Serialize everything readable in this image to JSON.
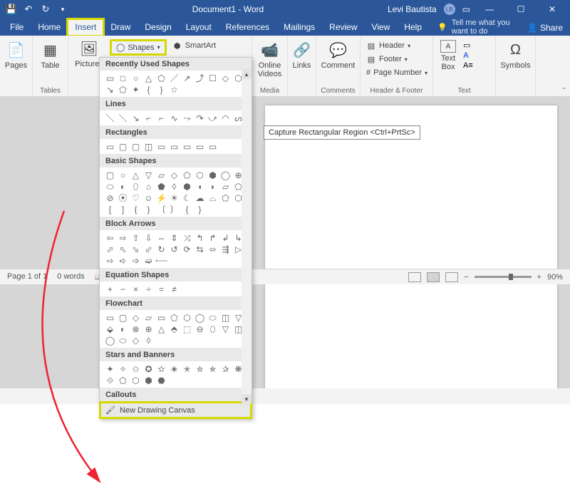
{
  "title": "Document1 - Word",
  "user": {
    "name": "Levi Bautista",
    "initials": "LB"
  },
  "tabs": [
    "File",
    "Home",
    "Insert",
    "Draw",
    "Design",
    "Layout",
    "References",
    "Mailings",
    "Review",
    "View",
    "Help"
  ],
  "tell_me": "Tell me what you want to do",
  "share": "Share",
  "ribbon": {
    "pages": "Pages",
    "table": "Table",
    "tables_label": "Tables",
    "pictures": "Pictures",
    "shapes": "Shapes",
    "smartart": "SmartArt",
    "online_videos": "Online\nVideos",
    "media_label": "Media",
    "links": "Links",
    "comment": "Comment",
    "comments_label": "Comments",
    "header": "Header",
    "footer": "Footer",
    "page_number": "Page Number",
    "hf_label": "Header & Footer",
    "text_box": "Text\nBox",
    "text_label": "Text",
    "symbols": "Symbols"
  },
  "shapes_dd": {
    "recently_used": "Recently Used Shapes",
    "lines": "Lines",
    "rectangles": "Rectangles",
    "basic": "Basic Shapes",
    "block_arrows": "Block Arrows",
    "equation": "Equation Shapes",
    "flowchart": "Flowchart",
    "stars": "Stars and Banners",
    "callouts": "Callouts",
    "new_canvas": "New Drawing Canvas"
  },
  "tooltip": "Capture Rectangular Region <Ctrl+PrtSc>",
  "status": {
    "page": "Page 1 of 1",
    "words": "0 words",
    "zoom": "90%"
  }
}
